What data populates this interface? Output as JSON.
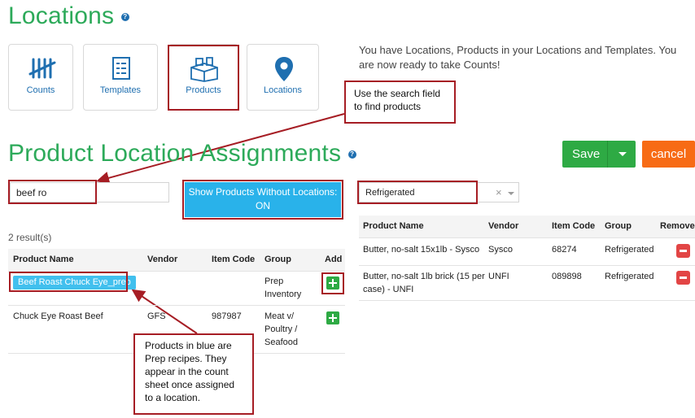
{
  "page": {
    "title": "Locations",
    "intro_text": "You have Locations, Products in your Locations and Templates. You are now ready to take Counts!"
  },
  "tiles": [
    {
      "label": "Counts",
      "icon": "tally-icon"
    },
    {
      "label": "Templates",
      "icon": "template-icon"
    },
    {
      "label": "Products",
      "icon": "boxes-icon"
    },
    {
      "label": "Locations",
      "icon": "map-pin-icon"
    }
  ],
  "assignments": {
    "title": "Product Location Assignments",
    "save_label": "Save",
    "cancel_label": "cancel",
    "search_value": "beef ro",
    "show_without_locations_line1": "Show Products Without Locations:",
    "show_without_locations_line2": "ON",
    "location_select_value": "Refrigerated",
    "result_count": "2 result(s)"
  },
  "left_table": {
    "headers": [
      "Product Name",
      "Vendor",
      "Item Code",
      "Group",
      "Add"
    ],
    "rows": [
      {
        "product": "Beef Roast Chuck Eye_prep",
        "vendor": "",
        "item_code": "",
        "group_line1": "Prep",
        "group_line2": "Inventory",
        "group_line3": ""
      },
      {
        "product": "Chuck Eye Roast Beef",
        "vendor": "GFS",
        "item_code": "987987",
        "group_line1": "Meat v/",
        "group_line2": "Poultry /",
        "group_line3": "Seafood"
      }
    ]
  },
  "right_table": {
    "headers": [
      "Product Name",
      "Vendor",
      "Item Code",
      "Group",
      "Remove"
    ],
    "rows": [
      {
        "product_line1": "Butter, no-salt 15x1lb - Sysco",
        "product_line2": "",
        "vendor": "Sysco",
        "item_code": "68274",
        "group": "Refrigerated"
      },
      {
        "product_line1": "Butter, no-salt 1lb brick (15 per",
        "product_line2": "case) - UNFI",
        "vendor": "UNFI",
        "item_code": "089898",
        "group": "Refrigerated"
      }
    ]
  },
  "callouts": {
    "search_tip_line1": "Use the search field",
    "search_tip_line2": "to find products",
    "prep_tip_line1": "Products in blue are",
    "prep_tip_line2": "Prep recipes. They",
    "prep_tip_line3": "appear in the count",
    "prep_tip_line4": "sheet once assigned",
    "prep_tip_line5": "to a location."
  },
  "colors": {
    "green_title": "#2daa5a",
    "save_green": "#2eaa44",
    "cancel_orange": "#f76b15",
    "show_button_blue": "#29b2ea",
    "prep_tag_blue": "#41c0ee",
    "annotation_red": "#a61d24",
    "remove_red": "#e24545"
  }
}
